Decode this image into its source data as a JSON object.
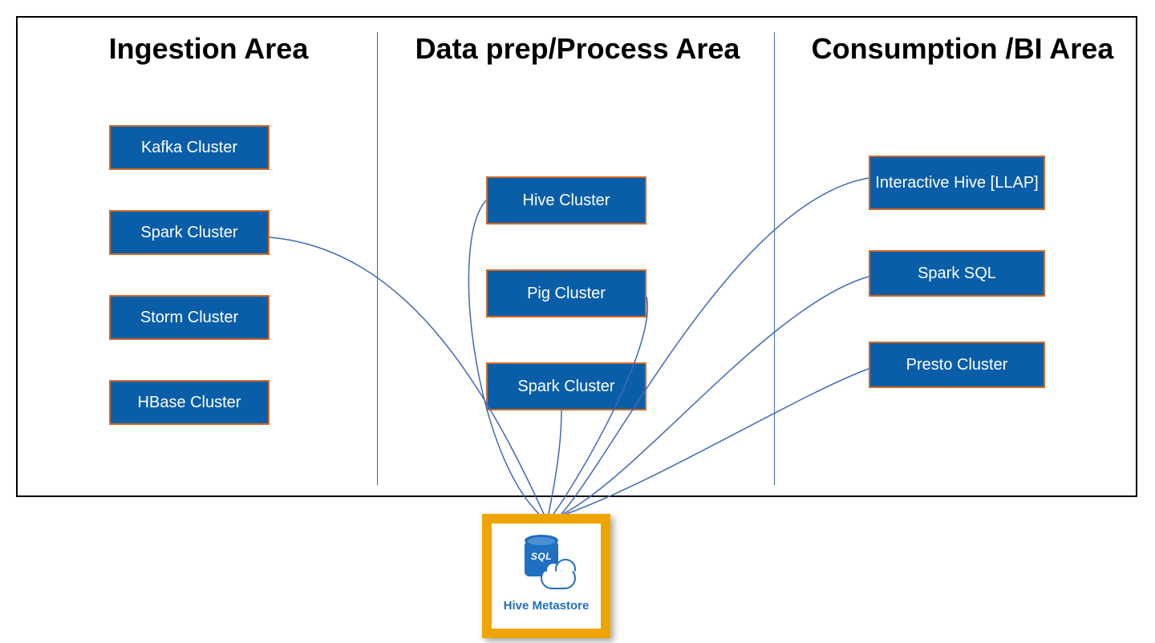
{
  "diagram": {
    "areas": {
      "ingestion": {
        "title": "Ingestion Area"
      },
      "processing": {
        "title": "Data prep/Process Area"
      },
      "consumption": {
        "title": "Consumption /BI Area"
      }
    },
    "nodes": {
      "ingestion": {
        "kafka": "Kafka Cluster",
        "spark": "Spark Cluster",
        "storm": "Storm Cluster",
        "hbase": "HBase Cluster"
      },
      "processing": {
        "hive": "Hive Cluster",
        "pig": "Pig Cluster",
        "spark": "Spark Cluster"
      },
      "consumption": {
        "llap": "Interactive Hive [LLAP]",
        "sparksql": "Spark SQL",
        "presto": "Presto Cluster"
      }
    },
    "metastore": {
      "label": "Hive Metastore",
      "icon_text": "SQL"
    },
    "connections_to_metastore_from": [
      "ingestion.spark",
      "processing.hive",
      "processing.pig",
      "processing.spark",
      "consumption.llap",
      "consumption.sparksql",
      "consumption.presto"
    ],
    "colors": {
      "node_fill": "#0a5ea8",
      "node_border": "#d36a24",
      "divider": "#4169b5",
      "wire": "#4169b5",
      "metastore_border": "#efa500",
      "metastore_text": "#1f6fc2"
    }
  }
}
